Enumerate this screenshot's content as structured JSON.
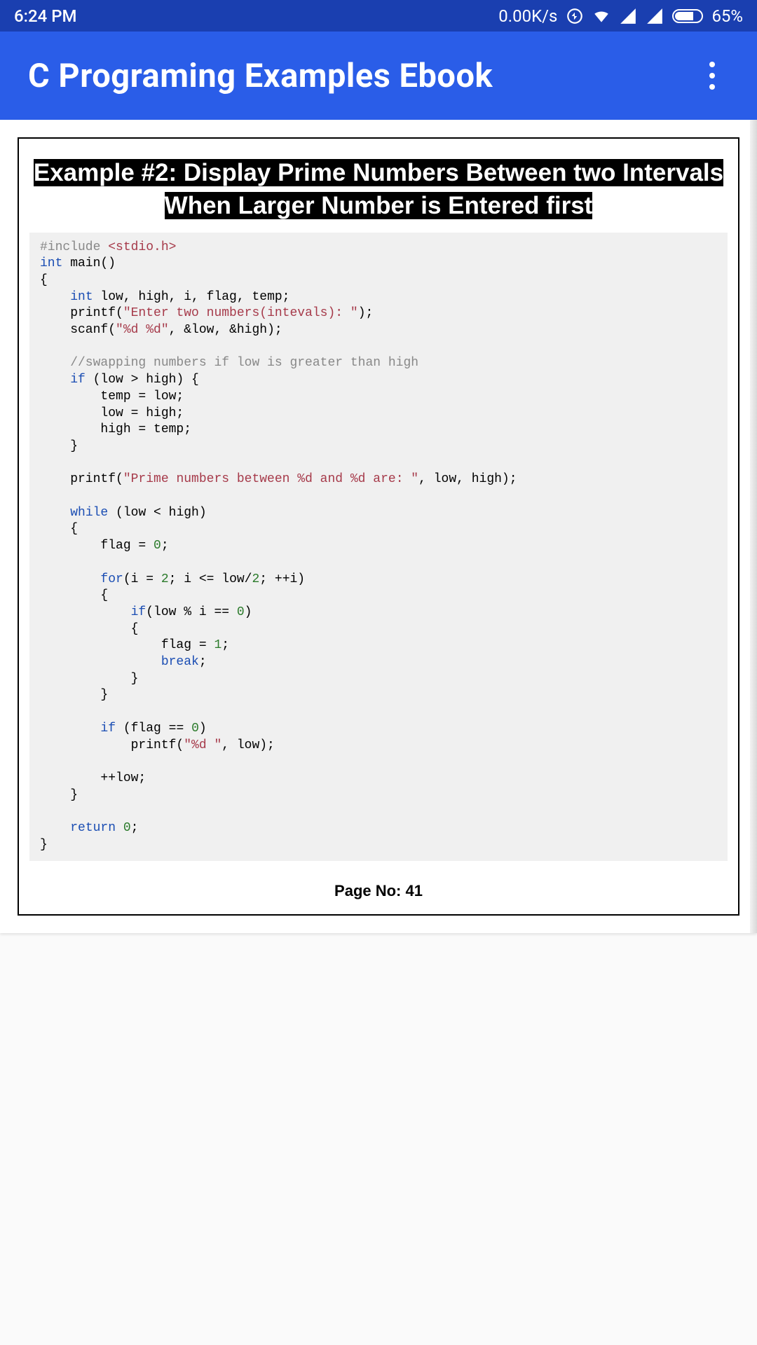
{
  "status": {
    "time": "6:24 PM",
    "netspeed": "0.00K/s",
    "battery_pct": "65%"
  },
  "appbar": {
    "title": "C Programing Examples Ebook"
  },
  "example": {
    "title": "Example #2: Display Prime Numbers Between two Intervals When Larger Number is Entered first"
  },
  "page": {
    "label": "Page No: 41"
  },
  "code": {
    "l01a": "#include ",
    "l01b": "<stdio.h>",
    "l02a": "int",
    "l02b": " main()",
    "l03": "{",
    "l04a": "    ",
    "l04b": "int",
    "l04c": " low, high, i, flag, temp;",
    "l05a": "    printf(",
    "l05b": "\"Enter two numbers(intevals): \"",
    "l05c": ");",
    "l06a": "    scanf(",
    "l06b": "\"%d %d\"",
    "l06c": ", &low, &high);",
    "l07": "",
    "l08": "    //swapping numbers if low is greater than high",
    "l09a": "    ",
    "l09b": "if",
    "l09c": " (low > high) {",
    "l10": "        temp = low;",
    "l11": "        low = high;",
    "l12": "        high = temp;",
    "l13": "    }",
    "l14": "",
    "l15a": "    printf(",
    "l15b": "\"Prime numbers between %d and %d are: \"",
    "l15c": ", low, high);",
    "l16": "",
    "l17a": "    ",
    "l17b": "while",
    "l17c": " (low < high)",
    "l18": "    {",
    "l19a": "        flag = ",
    "l19b": "0",
    "l19c": ";",
    "l20": "",
    "l21a": "        ",
    "l21b": "for",
    "l21c": "(i = ",
    "l21d": "2",
    "l21e": "; i <= low/",
    "l21f": "2",
    "l21g": "; ++i)",
    "l22": "        {",
    "l23a": "            ",
    "l23b": "if",
    "l23c": "(low % i == ",
    "l23d": "0",
    "l23e": ")",
    "l24": "            {",
    "l25a": "                flag = ",
    "l25b": "1",
    "l25c": ";",
    "l26a": "                ",
    "l26b": "break",
    "l26c": ";",
    "l27": "            }",
    "l28": "        }",
    "l29": "",
    "l30a": "        ",
    "l30b": "if",
    "l30c": " (flag == ",
    "l30d": "0",
    "l30e": ")",
    "l31a": "            printf(",
    "l31b": "\"%d \"",
    "l31c": ", low);",
    "l32": "",
    "l33": "        ++low;",
    "l34": "    }",
    "l35": "",
    "l36a": "    ",
    "l36b": "return",
    "l36c": " ",
    "l36d": "0",
    "l36e": ";",
    "l37": "}"
  }
}
